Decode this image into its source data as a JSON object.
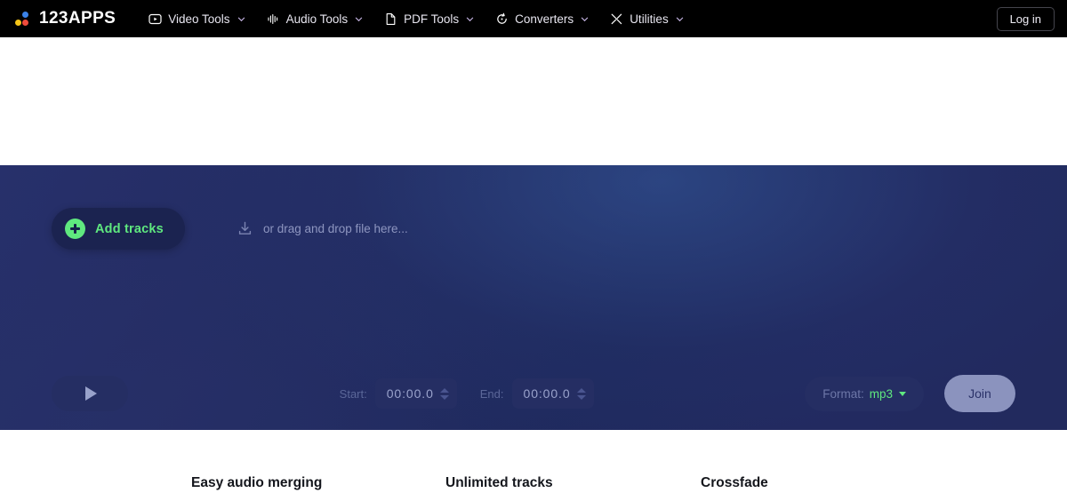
{
  "brand": {
    "name": "123APPS",
    "dots": [
      "blue-dot",
      "yellow-dot",
      "red-dot"
    ],
    "colors": {
      "blue": "#3b82e8",
      "yellow": "#f5c518",
      "red": "#ef4b3c"
    }
  },
  "topnav": {
    "items": [
      {
        "label": "Video Tools",
        "icon": "video-play-icon",
        "caret": "chevron-down-icon"
      },
      {
        "label": "Audio Tools",
        "icon": "audio-waveform-icon",
        "caret": "chevron-down-icon"
      },
      {
        "label": "PDF Tools",
        "icon": "document-page-icon",
        "caret": "chevron-down-icon"
      },
      {
        "label": "Converters",
        "icon": "circular-arrow-icon",
        "caret": "chevron-down-icon"
      },
      {
        "label": "Utilities",
        "icon": "tools-scissors-icon",
        "caret": "chevron-down-icon"
      }
    ],
    "login_label": "Log in",
    "background": "#000000"
  },
  "app": {
    "add_tracks_label": "Add tracks",
    "add_tracks_icon": "plus-circle-icon",
    "drag_hint": "or drag and drop file here...",
    "drag_icon": "download-arrow-icon",
    "accent_green": "#5fe87f",
    "panel_background": "#232c62"
  },
  "controls": {
    "play_icon": "play-triangle-icon",
    "start_label": "Start:",
    "start_value": "00:00.0",
    "end_label": "End:",
    "end_value": "00:00.0",
    "spinner_up_icon": "chevron-up-icon",
    "spinner_down_icon": "chevron-down-icon",
    "format_label": "Format:",
    "format_value": "mp3",
    "format_caret_icon": "chevron-down-icon",
    "join_label": "Join"
  },
  "features": [
    {
      "title": "Easy audio merging"
    },
    {
      "title": "Unlimited tracks"
    },
    {
      "title": "Crossfade"
    }
  ]
}
